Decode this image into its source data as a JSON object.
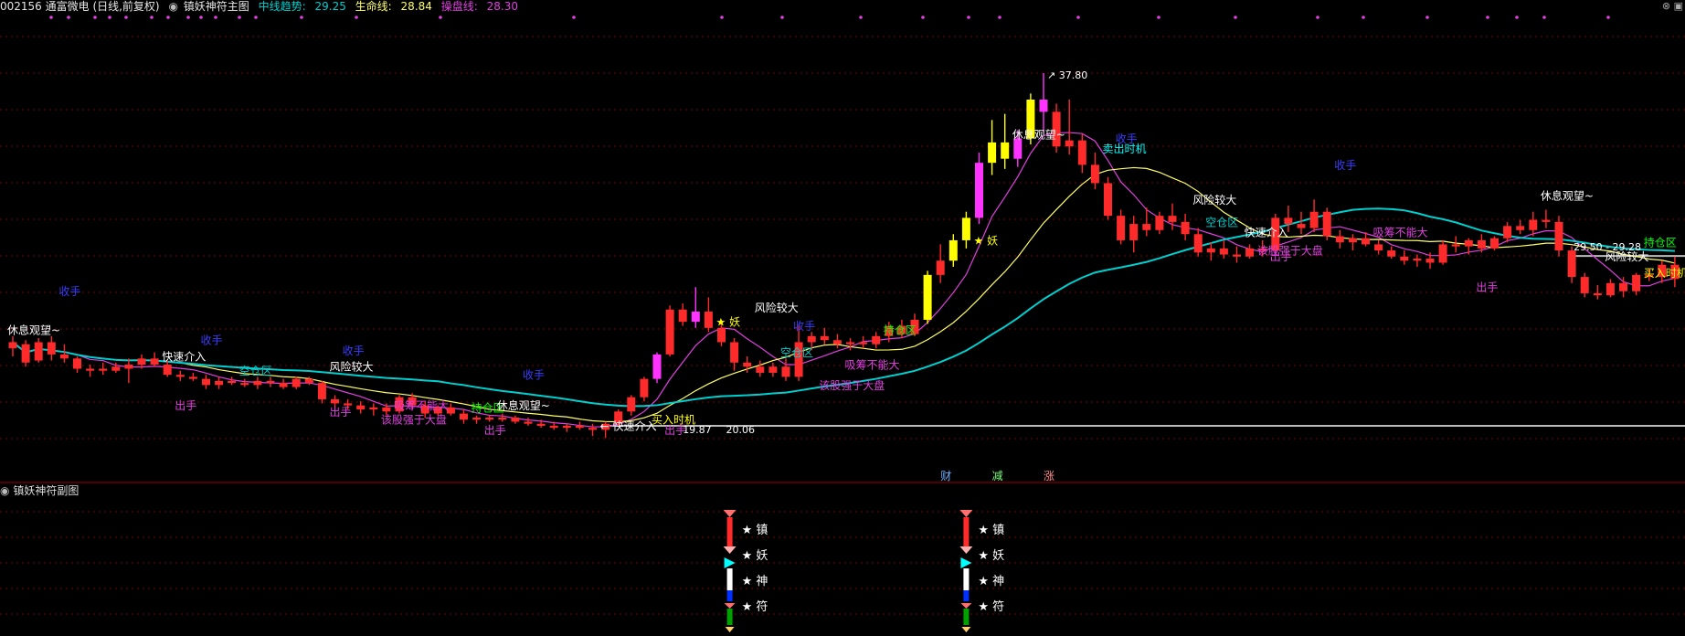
{
  "header": {
    "stock": "002156 通富微电 (日线,前复权)",
    "indicator_name": "镇妖神符主图",
    "mid_trend_label": "中线趋势:",
    "mid_trend_value": "29.25",
    "life_label": "生命线:",
    "life_value": "28.84",
    "op_label": "操盘线:",
    "op_value": "28.30"
  },
  "sub_panel": {
    "title": "镇妖神符副图",
    "labels": [
      "★ 镇",
      "★ 妖",
      "★ 神",
      "★ 符"
    ]
  },
  "colors": {
    "up": "#ff2a2a",
    "down": "#ff2a2a",
    "mid_trend": "#00cfcf",
    "life": "#ffff66",
    "op": "#e040e0",
    "grid": "#7a0000",
    "separator": "#a00000",
    "yellow_bar": "#ffff00",
    "magenta_bar": "#ff33ff"
  },
  "chart_data": {
    "type": "candlestick",
    "price_labels": {
      "high": "37.80",
      "low_left": "19.87",
      "low_right": "20.06",
      "right_a": "29.50",
      "right_b": "29.28"
    },
    "candles": [
      [
        24.3,
        24.9,
        23.9,
        24.6
      ],
      [
        24.5,
        24.7,
        23.4,
        23.6
      ],
      [
        23.7,
        24.8,
        23.6,
        24.6
      ],
      [
        24.6,
        24.9,
        23.7,
        24.0
      ],
      [
        24.0,
        24.5,
        23.6,
        23.8
      ],
      [
        23.8,
        23.9,
        23.1,
        23.3
      ],
      [
        23.3,
        23.5,
        22.9,
        23.2
      ],
      [
        23.2,
        23.6,
        23.0,
        23.3
      ],
      [
        23.4,
        23.6,
        23.1,
        23.2
      ],
      [
        23.3,
        23.8,
        22.6,
        23.5
      ],
      [
        23.5,
        24.0,
        23.3,
        23.8
      ],
      [
        23.8,
        24.1,
        23.4,
        23.5
      ],
      [
        23.5,
        23.7,
        22.9,
        23.0
      ],
      [
        23.0,
        23.2,
        22.7,
        22.9
      ],
      [
        22.9,
        23.1,
        22.7,
        22.8
      ],
      [
        22.8,
        23.0,
        22.3,
        22.5
      ],
      [
        22.5,
        22.9,
        22.3,
        22.7
      ],
      [
        22.7,
        22.9,
        22.5,
        22.6
      ],
      [
        22.6,
        22.8,
        22.4,
        22.5
      ],
      [
        22.5,
        22.9,
        22.3,
        22.7
      ],
      [
        22.7,
        22.9,
        22.4,
        22.6
      ],
      [
        22.6,
        22.8,
        22.3,
        22.4
      ],
      [
        22.4,
        22.9,
        22.3,
        22.8
      ],
      [
        22.8,
        22.9,
        22.5,
        22.6
      ],
      [
        22.6,
        22.7,
        21.6,
        21.8
      ],
      [
        21.8,
        22.0,
        21.4,
        21.6
      ],
      [
        21.6,
        21.8,
        21.3,
        21.5
      ],
      [
        21.5,
        21.7,
        21.1,
        21.3
      ],
      [
        21.3,
        21.6,
        21.0,
        21.4
      ],
      [
        21.4,
        21.6,
        21.0,
        21.2
      ],
      [
        21.2,
        22.0,
        21.1,
        21.9
      ],
      [
        21.9,
        22.1,
        21.3,
        21.5
      ],
      [
        21.5,
        21.7,
        20.9,
        21.1
      ],
      [
        21.1,
        21.5,
        21.0,
        21.4
      ],
      [
        21.4,
        21.6,
        21.0,
        21.1
      ],
      [
        21.1,
        21.3,
        20.6,
        20.8
      ],
      [
        20.8,
        21.0,
        20.6,
        20.9
      ],
      [
        20.9,
        21.0,
        20.7,
        20.8
      ],
      [
        20.8,
        21.1,
        20.7,
        20.9
      ],
      [
        20.9,
        21.0,
        20.6,
        20.7
      ],
      [
        20.7,
        20.9,
        20.5,
        20.6
      ],
      [
        20.6,
        20.8,
        20.4,
        20.5
      ],
      [
        20.5,
        20.7,
        20.3,
        20.4
      ],
      [
        20.4,
        20.6,
        20.2,
        20.5
      ],
      [
        20.5,
        20.7,
        20.3,
        20.4
      ],
      [
        20.4,
        20.6,
        20.0,
        20.3
      ],
      [
        20.3,
        20.7,
        19.9,
        20.6
      ],
      [
        20.6,
        21.3,
        20.5,
        21.2
      ],
      [
        21.2,
        22.0,
        21.0,
        21.9
      ],
      [
        21.9,
        22.9,
        21.7,
        22.8
      ],
      [
        22.8,
        24.1,
        22.6,
        24.0
      ],
      [
        24.0,
        26.4,
        23.9,
        26.2
      ],
      [
        26.2,
        26.5,
        25.4,
        25.6
      ],
      [
        25.6,
        27.3,
        25.3,
        26.1
      ],
      [
        26.1,
        26.8,
        25.1,
        25.3
      ],
      [
        25.3,
        25.7,
        24.4,
        24.6
      ],
      [
        24.6,
        24.8,
        23.2,
        23.6
      ],
      [
        23.6,
        23.9,
        23.1,
        23.4
      ],
      [
        23.4,
        23.7,
        22.9,
        23.1
      ],
      [
        23.1,
        23.6,
        22.9,
        23.4
      ],
      [
        23.4,
        23.8,
        22.7,
        22.9
      ],
      [
        22.9,
        25.4,
        22.7,
        24.6
      ],
      [
        24.6,
        25.1,
        24.2,
        24.9
      ],
      [
        24.9,
        25.3,
        24.5,
        24.7
      ],
      [
        24.7,
        25.0,
        24.3,
        24.5
      ],
      [
        24.5,
        24.8,
        24.2,
        24.6
      ],
      [
        24.6,
        24.9,
        24.3,
        24.5
      ],
      [
        24.5,
        25.1,
        24.3,
        24.9
      ],
      [
        24.9,
        25.6,
        24.6,
        25.4
      ],
      [
        25.4,
        25.7,
        24.8,
        25.0
      ],
      [
        25.0,
        26.0,
        24.9,
        25.7
      ],
      [
        25.7,
        28.1,
        25.5,
        27.9
      ],
      [
        27.9,
        29.4,
        27.5,
        28.6
      ],
      [
        28.6,
        29.9,
        28.3,
        29.6
      ],
      [
        29.6,
        31.0,
        29.2,
        30.7
      ],
      [
        30.7,
        33.9,
        30.4,
        33.4
      ],
      [
        33.4,
        35.5,
        32.8,
        34.4
      ],
      [
        34.4,
        35.8,
        33.1,
        33.6
      ],
      [
        33.6,
        35.0,
        33.2,
        34.6
      ],
      [
        34.6,
        36.8,
        34.3,
        36.5
      ],
      [
        36.5,
        37.8,
        34.9,
        35.9
      ],
      [
        35.9,
        36.3,
        33.9,
        34.2
      ],
      [
        34.2,
        36.5,
        33.8,
        34.5
      ],
      [
        34.5,
        34.8,
        32.9,
        33.3
      ],
      [
        33.3,
        33.9,
        32.1,
        32.4
      ],
      [
        32.4,
        32.7,
        30.6,
        30.8
      ],
      [
        30.8,
        31.1,
        29.4,
        29.6
      ],
      [
        29.6,
        30.8,
        29.0,
        30.4
      ],
      [
        30.4,
        31.2,
        29.8,
        30.1
      ],
      [
        30.1,
        31.0,
        29.9,
        30.8
      ],
      [
        30.8,
        31.4,
        30.1,
        30.5
      ],
      [
        30.5,
        30.9,
        29.6,
        29.9
      ],
      [
        29.9,
        30.2,
        28.8,
        29.0
      ],
      [
        29.0,
        29.5,
        28.6,
        29.2
      ],
      [
        29.2,
        29.6,
        28.7,
        28.9
      ],
      [
        28.9,
        29.3,
        28.5,
        28.8
      ],
      [
        28.8,
        29.4,
        28.7,
        29.2
      ],
      [
        29.2,
        29.6,
        28.8,
        29.1
      ],
      [
        29.1,
        30.9,
        29.0,
        30.7
      ],
      [
        30.7,
        31.3,
        30.0,
        30.4
      ],
      [
        30.4,
        31.0,
        29.9,
        30.2
      ],
      [
        30.2,
        31.6,
        30.0,
        31.0
      ],
      [
        31.0,
        31.2,
        29.6,
        29.8
      ],
      [
        29.8,
        30.1,
        29.2,
        29.5
      ],
      [
        29.5,
        29.9,
        29.1,
        29.7
      ],
      [
        29.7,
        30.0,
        29.3,
        29.4
      ],
      [
        29.4,
        29.6,
        28.9,
        29.1
      ],
      [
        29.1,
        29.3,
        28.7,
        28.8
      ],
      [
        28.8,
        29.1,
        28.4,
        28.6
      ],
      [
        28.6,
        28.9,
        28.3,
        28.7
      ],
      [
        28.7,
        29.0,
        28.2,
        28.5
      ],
      [
        28.5,
        29.6,
        28.4,
        29.4
      ],
      [
        29.4,
        29.8,
        29.0,
        29.3
      ],
      [
        29.3,
        29.7,
        28.9,
        29.6
      ],
      [
        29.6,
        29.9,
        29.0,
        29.2
      ],
      [
        29.2,
        29.8,
        29.1,
        29.7
      ],
      [
        29.7,
        30.5,
        29.5,
        30.3
      ],
      [
        30.3,
        30.6,
        29.9,
        30.1
      ],
      [
        30.1,
        31.0,
        29.8,
        30.6
      ],
      [
        30.6,
        31.1,
        30.2,
        30.5
      ],
      [
        30.5,
        30.8,
        28.8,
        29.1
      ],
      [
        29.1,
        29.3,
        27.5,
        27.8
      ],
      [
        27.8,
        28.0,
        26.8,
        27.0
      ],
      [
        27.0,
        27.4,
        26.7,
        26.9
      ],
      [
        26.9,
        27.7,
        26.8,
        27.5
      ],
      [
        27.5,
        27.8,
        26.8,
        27.1
      ],
      [
        27.1,
        28.0,
        26.9,
        27.9
      ],
      [
        27.9,
        28.2,
        27.6,
        27.8
      ],
      [
        27.8,
        28.6,
        27.5,
        28.4
      ],
      [
        28.4,
        28.8,
        27.3,
        27.7
      ]
    ],
    "annotations": [
      {
        "text": "休息观望~",
        "i": 0,
        "p": 25.0,
        "c": "#ffffff"
      },
      {
        "text": "收手",
        "i": 4,
        "p": 26.9,
        "c": "#3c3cff"
      },
      {
        "text": "快速介入",
        "i": 12,
        "p": 23.7,
        "c": "#ffffff"
      },
      {
        "text": "收手",
        "i": 15,
        "p": 24.5,
        "c": "#3c3cff"
      },
      {
        "text": "空仓区",
        "i": 18,
        "p": 23.0,
        "c": "#00d0d0"
      },
      {
        "text": "出手",
        "i": 13,
        "p": 21.3,
        "c": "#e040e0"
      },
      {
        "text": "风险较大",
        "i": 25,
        "p": 23.2,
        "c": "#ffffff"
      },
      {
        "text": "收手",
        "i": 26,
        "p": 24.0,
        "c": "#3c3cff"
      },
      {
        "text": "出手",
        "i": 25,
        "p": 21.0,
        "c": "#e040e0"
      },
      {
        "text": "吸筹不能大",
        "i": 30,
        "p": 21.3,
        "c": "#e040e0"
      },
      {
        "text": "该股强于大盘",
        "i": 29,
        "p": 20.6,
        "c": "#e040e0"
      },
      {
        "text": "持仓区",
        "i": 36,
        "p": 21.2,
        "c": "#00ff00"
      },
      {
        "text": "休息观望~",
        "i": 38,
        "p": 21.3,
        "c": "#ffffff"
      },
      {
        "text": "出手",
        "i": 37,
        "p": 20.1,
        "c": "#e040e0"
      },
      {
        "text": "收手",
        "i": 40,
        "p": 22.8,
        "c": "#3c3cff"
      },
      {
        "text": "← 快速介入",
        "i": 46,
        "p": 20.3,
        "c": "#ffffff"
      },
      {
        "text": "买入时机",
        "i": 50,
        "p": 20.6,
        "c": "#ffff00"
      },
      {
        "text": "出手",
        "i": 51,
        "p": 20.1,
        "c": "#e040e0"
      },
      {
        "text": "★ 妖",
        "i": 55,
        "p": 25.4,
        "c": "#ffff00"
      },
      {
        "text": "风险较大",
        "i": 58,
        "p": 26.1,
        "c": "#ffffff"
      },
      {
        "text": "收手",
        "i": 61,
        "p": 25.2,
        "c": "#3c3cff"
      },
      {
        "text": "空仓区",
        "i": 60,
        "p": 23.9,
        "c": "#00d0d0"
      },
      {
        "text": "吸筹不能大",
        "i": 65,
        "p": 23.3,
        "c": "#e040e0"
      },
      {
        "text": "持仓区",
        "i": 68,
        "p": 25.0,
        "c": "#00ff00"
      },
      {
        "text": "该股强于大盘",
        "i": 63,
        "p": 22.3,
        "c": "#e040e0"
      },
      {
        "text": "★ 妖",
        "i": 75,
        "p": 29.4,
        "c": "#ffff00"
      },
      {
        "text": "休息观望~",
        "i": 78,
        "p": 34.6,
        "c": "#ffffff"
      },
      {
        "text": "收手",
        "i": 86,
        "p": 34.4,
        "c": "#3c3cff"
      },
      {
        "text": "卖出时机",
        "i": 85,
        "p": 33.9,
        "c": "#00ffff"
      },
      {
        "text": "风险较大",
        "i": 92,
        "p": 31.4,
        "c": "#ffffff"
      },
      {
        "text": "空仓区",
        "i": 93,
        "p": 30.3,
        "c": "#00d0d0"
      },
      {
        "text": "收手",
        "i": 103,
        "p": 33.1,
        "c": "#3c3cff"
      },
      {
        "text": "快速介入",
        "i": 96,
        "p": 29.8,
        "c": "#ffffff"
      },
      {
        "text": "该股强于大盘",
        "i": 97,
        "p": 28.9,
        "c": "#e040e0"
      },
      {
        "text": "出手",
        "i": 98,
        "p": 28.6,
        "c": "#e040e0"
      },
      {
        "text": "吸筹不能大",
        "i": 106,
        "p": 29.8,
        "c": "#e040e0"
      },
      {
        "text": "休息观望~",
        "i": 119,
        "p": 31.6,
        "c": "#ffffff"
      },
      {
        "text": "出手",
        "i": 114,
        "p": 27.1,
        "c": "#e040e0"
      },
      {
        "text": "风险较大",
        "i": 124,
        "p": 28.6,
        "c": "#ffffff"
      },
      {
        "text": "持仓区",
        "i": 127,
        "p": 29.3,
        "c": "#00ff00"
      },
      {
        "text": "买入时机",
        "i": 127,
        "p": 27.8,
        "c": "#ffff00"
      }
    ],
    "event_marks": [
      {
        "text": "财",
        "i": 72,
        "c": "#6fb0ff"
      },
      {
        "text": "减",
        "i": 76,
        "c": "#7cff7c"
      },
      {
        "text": "涨",
        "i": 80,
        "c": "#ff8c8c"
      }
    ],
    "signal_groups": [
      56,
      74
    ]
  }
}
